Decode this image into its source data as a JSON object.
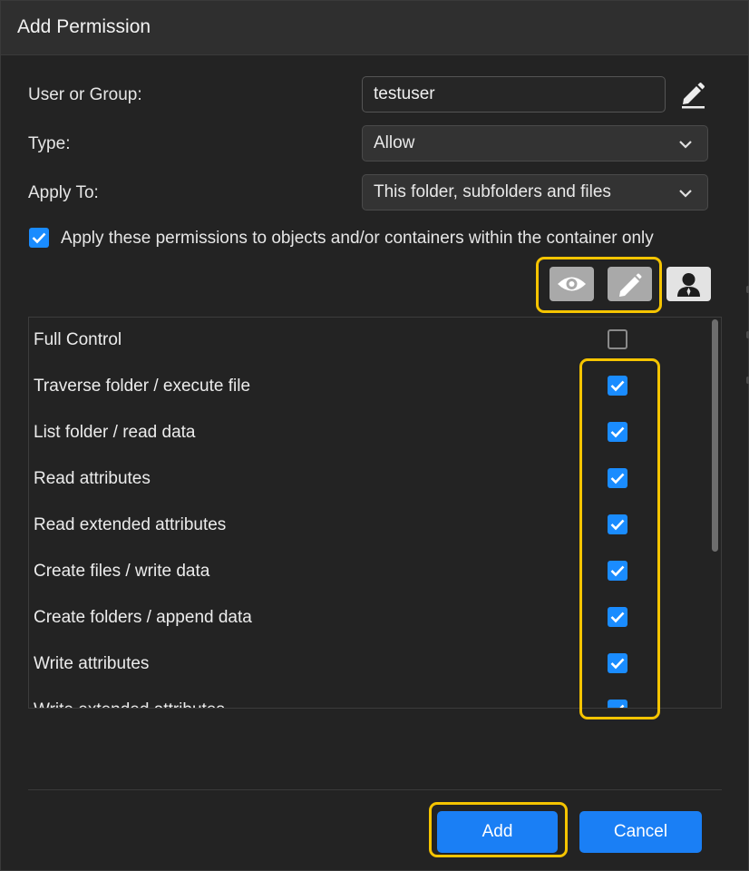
{
  "dialog": {
    "title": "Add Permission"
  },
  "form": {
    "user_label": "User or Group:",
    "user_value": "testuser",
    "type_label": "Type:",
    "type_value": "Allow",
    "apply_to_label": "Apply To:",
    "apply_to_value": "This folder, subfolders and files",
    "apply_within_checked": true,
    "apply_within_text": "Apply these permissions to objects and/or containers within the container only"
  },
  "toolbar": {
    "icons": [
      "eye-icon",
      "pencil-icon",
      "user-icon"
    ]
  },
  "permissions": [
    {
      "label": "Full Control",
      "checked": false
    },
    {
      "label": "Traverse folder / execute file",
      "checked": true
    },
    {
      "label": "List folder / read data",
      "checked": true
    },
    {
      "label": "Read attributes",
      "checked": true
    },
    {
      "label": "Read extended attributes",
      "checked": true
    },
    {
      "label": "Create files / write data",
      "checked": true
    },
    {
      "label": "Create folders / append data",
      "checked": true
    },
    {
      "label": "Write attributes",
      "checked": true
    },
    {
      "label": "Write extended attributes",
      "checked": true
    }
  ],
  "buttons": {
    "add_label": "Add",
    "cancel_label": "Cancel"
  },
  "colors": {
    "accent": "#1a8cff",
    "highlight": "#f5c400",
    "background": "#232323"
  }
}
